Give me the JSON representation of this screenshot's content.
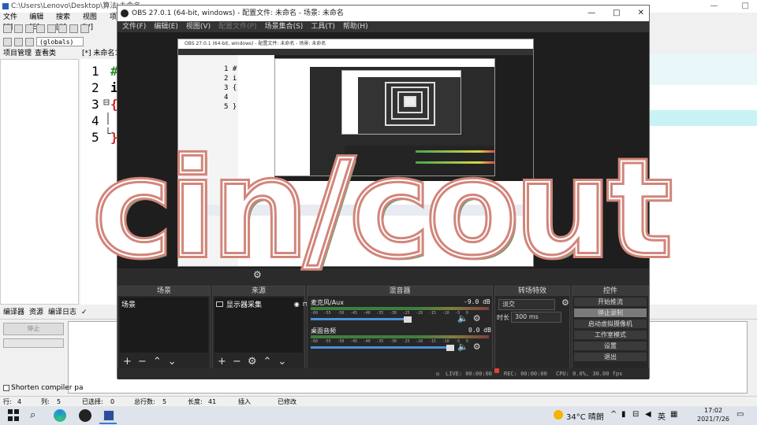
{
  "ide": {
    "title": "C:\\Users\\Lenovo\\Desktop\\算法\\未命名",
    "window_controls": [
      "—",
      "□"
    ],
    "menu": [
      "文件[F]",
      "编辑[E]",
      "搜索[S]",
      "视图[V]",
      "项"
    ],
    "scope": "(globals)",
    "left_tabs": [
      "项目管理",
      "查看类"
    ],
    "editor_tab": "[*] 未命名1.c",
    "line_numbers": [
      "1",
      "2",
      "3",
      "4",
      "5"
    ],
    "fold_marks": [
      "⊟",
      "│",
      "└"
    ],
    "code_lines": [
      "#",
      "i",
      "{",
      "",
      "}"
    ],
    "bottom_tabs": [
      "编译器",
      "资源",
      "编译日志",
      "✓"
    ],
    "compile_button": "停止",
    "shorten_label": "Shorten compiler pa",
    "status": {
      "row_label": "行:",
      "row": "4",
      "col_label": "列:",
      "col": "5",
      "selected_label": "已选择:",
      "selected": "0",
      "total_label": "总行数:",
      "total": "5",
      "length_label": "长度:",
      "length": "41",
      "mode": "插入",
      "modified": "已修改"
    }
  },
  "obs": {
    "title": "OBS 27.0.1 (64-bit, windows) - 配置文件: 未命名 - 场景: 未命名",
    "window_controls": [
      "—",
      "□",
      "✕"
    ],
    "menu": [
      "文件(F)",
      "编辑(E)",
      "视图(V)",
      "配置文件(P)",
      "场景集合(S)",
      "工具(T)",
      "帮助(H)"
    ],
    "nested_title": "OBS 27.0.1 (64-bit, windows) - 配置文件: 未命名 - 场景: 未命名",
    "nested_code": [
      "1 #",
      "2 i",
      "3 {",
      "4",
      "5 }"
    ],
    "docks": {
      "scenes": {
        "title": "场景",
        "items": [
          "场景"
        ]
      },
      "sources": {
        "title": "来源",
        "items": [
          "显示器采集"
        ]
      },
      "mixer": {
        "title": "混音器",
        "channels": [
          {
            "name": "麦克风/Aux",
            "db": "-9.0 dB"
          },
          {
            "name": "桌面音频",
            "db": "0.0 dB"
          }
        ],
        "scale": [
          "-60",
          "-55",
          "-50",
          "-45",
          "-40",
          "-35",
          "-30",
          "-25",
          "-20",
          "-15",
          "-10",
          "-5",
          "0"
        ]
      },
      "transitions": {
        "title": "转场特效",
        "type": "淡交",
        "duration_label": "时长",
        "duration": "300 ms"
      },
      "controls": {
        "title": "控件",
        "buttons": [
          "开始推流",
          "停止录制",
          "启动虚拟摄像机",
          "工作室模式",
          "设置",
          "退出"
        ]
      }
    },
    "status": {
      "live": "LIVE: 00:00:00",
      "rec": "REC: 00:00:00",
      "cpu": "CPU: 0.0%, 30.00 fps"
    }
  },
  "overlay": {
    "text": "cin/cout"
  },
  "taskbar": {
    "weather": "34°C 晴朗",
    "ime": "英",
    "time": "17:02",
    "date": "2021/7/26",
    "icons": [
      "windows-start",
      "search",
      "edge",
      "obs",
      "devcpp"
    ]
  },
  "colors": {
    "overlay_stroke": "#d2857a",
    "overlay_shadow": "#6f9b72",
    "obs_bg": "#2b2b2b",
    "accent": "#3a78d6"
  }
}
